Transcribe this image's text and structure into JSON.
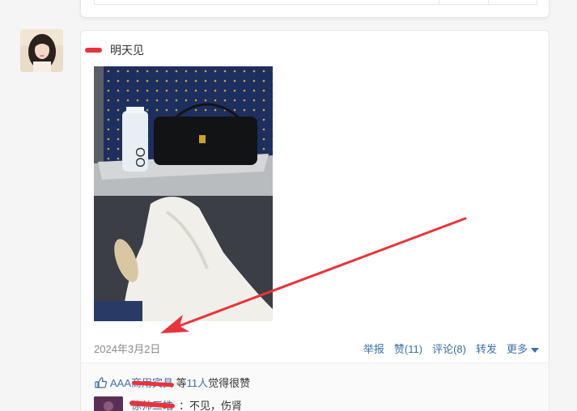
{
  "post": {
    "text": "明天见",
    "date": "2024年3月2日"
  },
  "actions": {
    "report": "举报",
    "like": "赞(11)",
    "comment": "评论(8)",
    "share": "转发",
    "more": "更多"
  },
  "likes": {
    "liker": "AAA商用宾具",
    "middle": "等",
    "count": "11人",
    "suffix": "觉得很赞"
  },
  "comment": {
    "author": "徐帅三皓",
    "text": "：不见，伤肾"
  },
  "colors": {
    "link": "#3b6eaa",
    "redaction": "#e8333a",
    "annotation_arrow": "#e8333a"
  }
}
